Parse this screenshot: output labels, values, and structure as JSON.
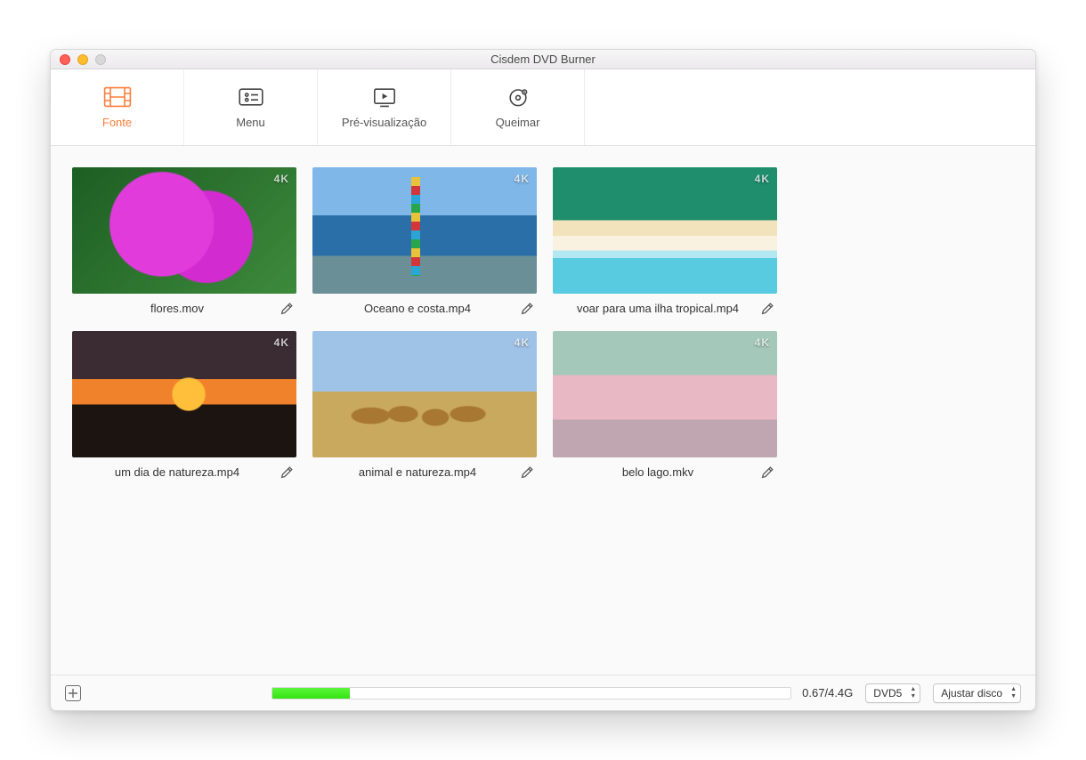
{
  "window": {
    "title": "Cisdem DVD Burner"
  },
  "tabs": [
    {
      "label": "Fonte",
      "active": true
    },
    {
      "label": "Menu",
      "active": false
    },
    {
      "label": "Pré-visualização",
      "active": false
    },
    {
      "label": "Queimar",
      "active": false
    }
  ],
  "items": [
    {
      "name": "flores.mov",
      "badge": "4K",
      "thumb": "th-flowers"
    },
    {
      "name": "Oceano e costa.mp4",
      "badge": "4K",
      "thumb": "th-ocean"
    },
    {
      "name": "voar para uma ilha tropical.mp4",
      "badge": "4K",
      "thumb": "th-island"
    },
    {
      "name": "um dia de natureza.mp4",
      "badge": "4K",
      "thumb": "th-sunset"
    },
    {
      "name": "animal e natureza.mp4",
      "badge": "4K",
      "thumb": "th-giraffes"
    },
    {
      "name": "belo lago.mkv",
      "badge": "4K",
      "thumb": "th-lake"
    }
  ],
  "footer": {
    "usage": "0.67/4.4G",
    "progress_pct": 15,
    "disc_select": "DVD5",
    "fit_select": "Ajustar disco"
  }
}
